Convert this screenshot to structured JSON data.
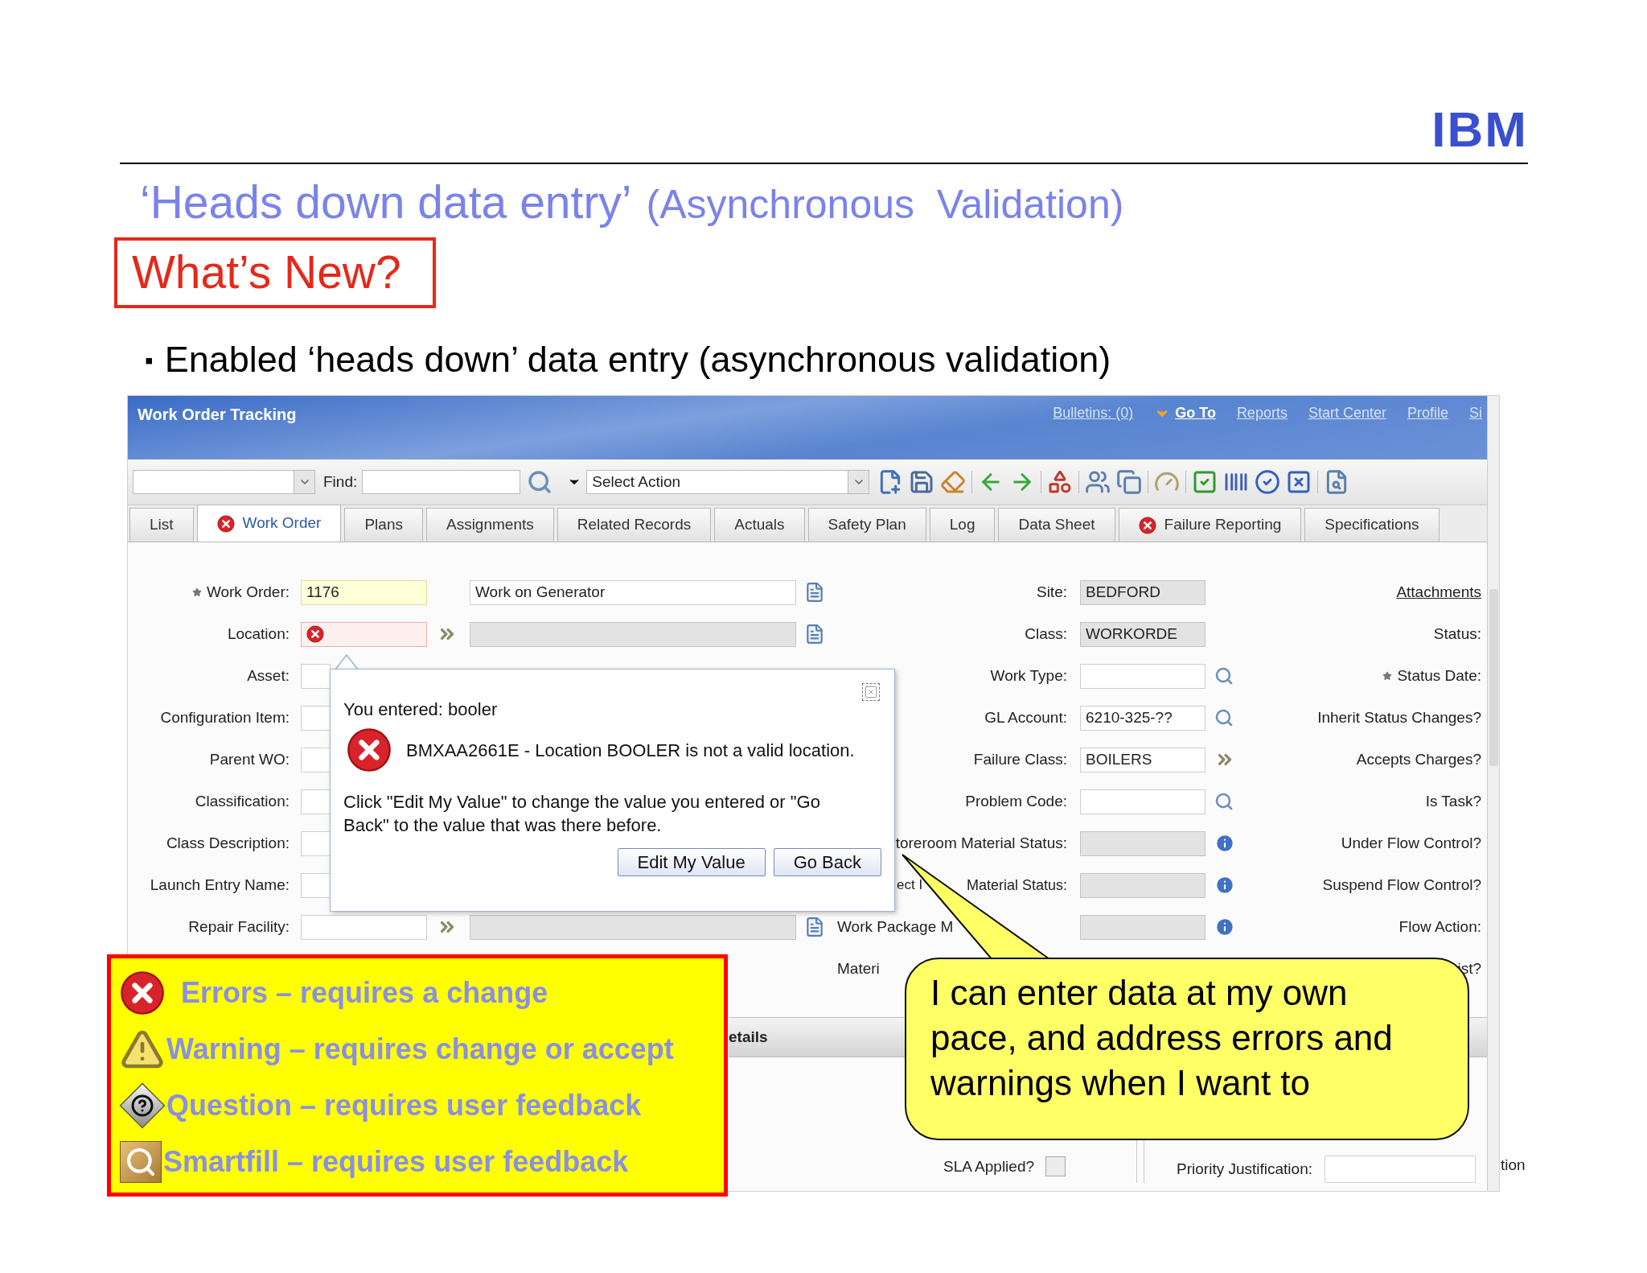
{
  "logo": "IBM",
  "title": {
    "main": "‘Heads down data entry’",
    "sub": "(Asynchronous  Validation)"
  },
  "badge": "What’s New?",
  "bullets": [
    {
      "marker": "▪",
      "text": "Enabled ‘heads down’ data entry (asynchronous validation)"
    }
  ],
  "app": {
    "title": "Work Order Tracking",
    "nav": [
      {
        "label": "Bulletins: (0)",
        "kind": "link"
      },
      {
        "label": "Go To",
        "kind": "menu"
      },
      {
        "label": "Reports",
        "kind": "link"
      },
      {
        "label": "Start Center",
        "kind": "link"
      },
      {
        "label": "Profile",
        "kind": "link"
      },
      {
        "label": "Si",
        "kind": "link"
      }
    ],
    "toolbar": {
      "find_label": "Find:",
      "action_select": "Select Action"
    },
    "tabs": [
      {
        "label": "List",
        "selected": false,
        "error": false
      },
      {
        "label": "Work Order",
        "selected": true,
        "error": true
      },
      {
        "label": "Plans",
        "selected": false,
        "error": false
      },
      {
        "label": "Assignments",
        "selected": false,
        "error": false
      },
      {
        "label": "Related Records",
        "selected": false,
        "error": false
      },
      {
        "label": "Actuals",
        "selected": false,
        "error": false
      },
      {
        "label": "Safety Plan",
        "selected": false,
        "error": false
      },
      {
        "label": "Log",
        "selected": false,
        "error": false
      },
      {
        "label": "Data Sheet",
        "selected": false,
        "error": false
      },
      {
        "label": "Failure Reporting",
        "selected": false,
        "error": true
      },
      {
        "label": "Specifications",
        "selected": false,
        "error": false
      }
    ],
    "form": {
      "left": [
        {
          "label": "Work Order:",
          "required": true,
          "field": {
            "kind": "highlight",
            "value": "1176"
          },
          "more": false,
          "description": {
            "kind": "text",
            "value": "Work on Generator"
          },
          "note": true
        },
        {
          "label": "Location:",
          "required": false,
          "field": {
            "kind": "error"
          },
          "more": true,
          "description": {
            "kind": "readonly"
          },
          "note": true
        },
        {
          "label": "Asset:",
          "required": false,
          "field": {
            "kind": "text"
          },
          "more": false,
          "note": false
        },
        {
          "label": "Configuration Item:",
          "required": false,
          "field": {
            "kind": "text"
          },
          "more": false,
          "note": false
        },
        {
          "label": "Parent WO:",
          "required": false,
          "field": {
            "kind": "text"
          },
          "more": false,
          "note": false
        },
        {
          "label": "Classification:",
          "required": false,
          "field": {
            "kind": "text"
          },
          "more": false,
          "note": false
        },
        {
          "label": "Class Description:",
          "required": false,
          "field": {
            "kind": "text"
          },
          "more": false,
          "note": false
        },
        {
          "label": "Launch Entry Name:",
          "required": false,
          "field": {
            "kind": "text"
          },
          "more": false,
          "note": false
        },
        {
          "label": "Repair Facility:",
          "required": false,
          "field": {
            "kind": "text"
          },
          "more": true,
          "description": {
            "kind": "readonly"
          },
          "note": true
        }
      ],
      "middle": [
        {
          "label": "Site:",
          "field": {
            "kind": "readonly",
            "value": "BEDFORD"
          }
        },
        {
          "label": "Class:",
          "field": {
            "kind": "readonly",
            "value": "WORKORDE"
          }
        },
        {
          "label": "Work Type:",
          "field": {
            "kind": "text"
          },
          "button": {
            "kind": "search"
          }
        },
        {
          "label": "GL Account:",
          "field": {
            "kind": "text",
            "value": "6210-325-??"
          },
          "button": {
            "kind": "search"
          }
        },
        {
          "label": "Failure Class:",
          "field": {
            "kind": "text",
            "value": "BOILERS"
          },
          "button": {
            "kind": "more"
          }
        },
        {
          "label": "Problem Code:",
          "field": {
            "kind": "text"
          },
          "button": {
            "kind": "search"
          }
        },
        {
          "label": "toreroom Material Status:",
          "field": {
            "kind": "readonly"
          },
          "button": {
            "kind": "info"
          }
        },
        {
          "label_left": "ect I",
          "label": "Material Status:",
          "field": {
            "kind": "readonly"
          },
          "button": {
            "kind": "info"
          }
        },
        {
          "label_left": "Work Package M",
          "field": {
            "kind": "readonly"
          },
          "button": {
            "kind": "info"
          }
        },
        {
          "label_left": "Materi"
        }
      ],
      "right": [
        {
          "label": "Attachments",
          "kind": "link",
          "required": false
        },
        {
          "label": "Status:",
          "kind": "label",
          "required": false
        },
        {
          "label": "Status Date:",
          "kind": "label",
          "required": true
        },
        {
          "label": "Inherit Status Changes?",
          "kind": "label",
          "required": false
        },
        {
          "label": "Accepts Charges?",
          "kind": "label",
          "required": false
        },
        {
          "label": "Is Task?",
          "kind": "label",
          "required": false
        },
        {
          "label": "Under Flow Control?",
          "kind": "label",
          "required": false
        },
        {
          "label": "Suspend Flow Control?",
          "kind": "label",
          "required": false
        },
        {
          "label": "Flow Action:",
          "kind": "label",
          "required": false
        },
        {
          "label": "ist?",
          "kind": "label",
          "required": false
        }
      ]
    },
    "section": "etails",
    "bottom": {
      "sla_label": "SLA Applied?",
      "sla_checked": false,
      "priority_justification_label": "Priority Justification:",
      "cut_label": "tion"
    }
  },
  "dialog": {
    "entered": "You entered: booler",
    "message": "BMXAA2661E - Location BOOLER is not a valid location.",
    "hint": "Click \"Edit My Value\" to change the value you entered or \"Go Back\" to the value that was there before.",
    "buttons": [
      "Edit My Value",
      "Go Back"
    ]
  },
  "legend": [
    {
      "kind": "error",
      "text": "Errors – requires a change"
    },
    {
      "kind": "warning",
      "text": "Warning – requires change or accept"
    },
    {
      "kind": "question",
      "text": "Question – requires user feedback"
    },
    {
      "kind": "smartfill",
      "text": "Smartfill – requires user feedback"
    }
  ],
  "callout": "I can enter data at my own pace, and address errors and warnings when I want to"
}
